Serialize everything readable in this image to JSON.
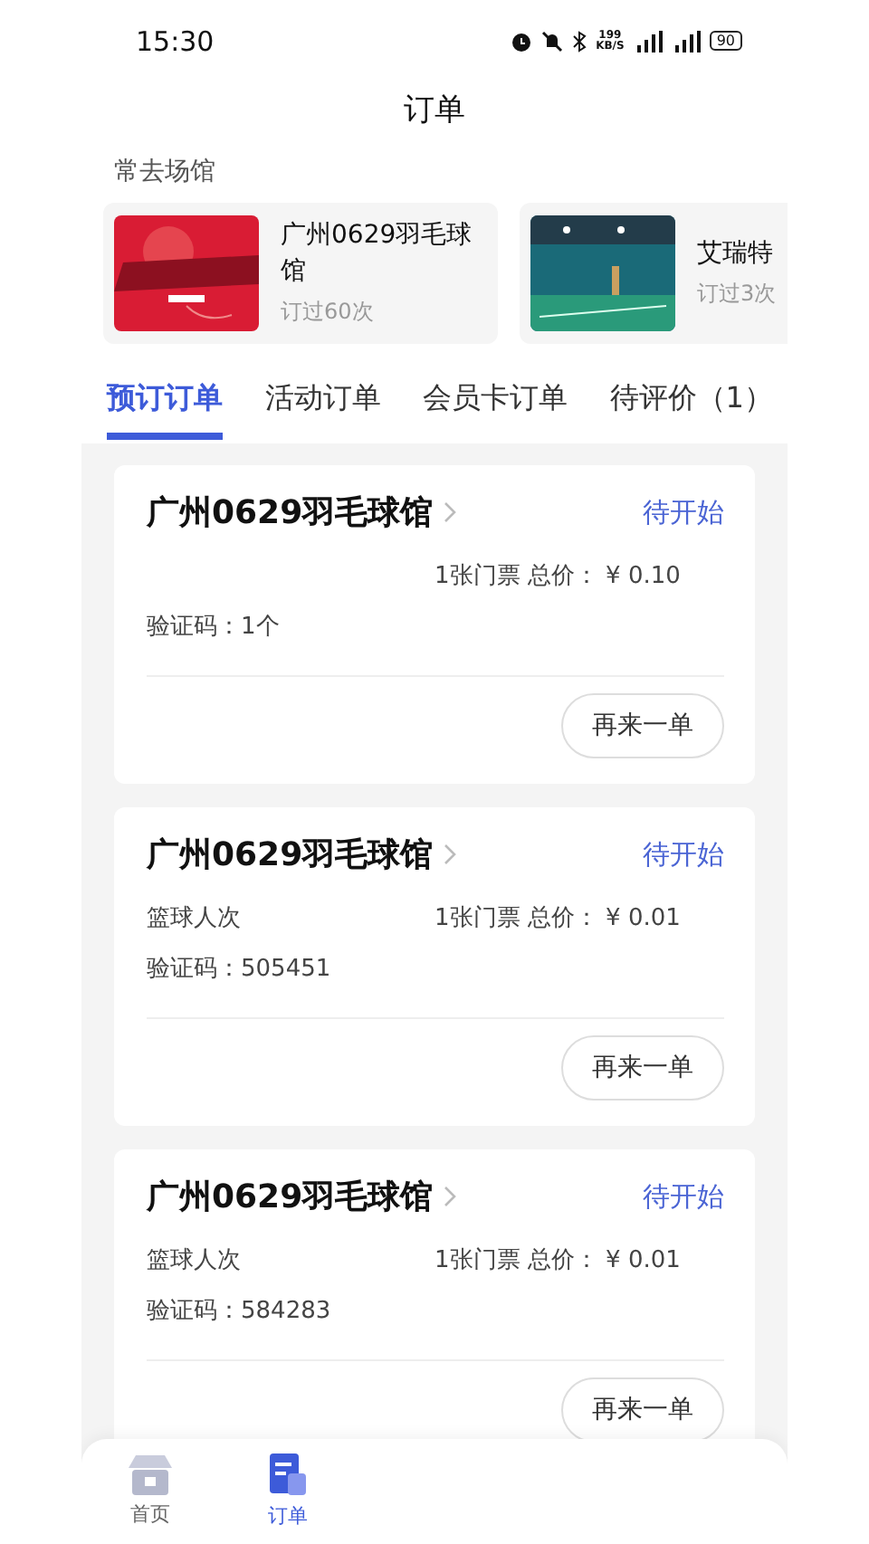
{
  "status_bar": {
    "time": "15:30",
    "speed": "199",
    "speed_unit": "KB/S",
    "battery": "90"
  },
  "title": "订单",
  "frequent": {
    "heading": "常去场馆",
    "venues": [
      {
        "name": "广州0629羽毛球馆",
        "visits": "订过60次"
      },
      {
        "name": "艾瑞特",
        "visits": "订过3次"
      }
    ]
  },
  "tabs": [
    {
      "label": "预订订单",
      "selected": true
    },
    {
      "label": "活动订单",
      "selected": false
    },
    {
      "label": "会员卡订单",
      "selected": false
    },
    {
      "label": "待评价（1）",
      "selected": false
    }
  ],
  "orders": [
    {
      "venue": "广州0629羽毛球馆",
      "status": "待开始",
      "tickets": "1张门票 总价：",
      "price": "¥ 0.10",
      "code": "验证码：1个",
      "button": "再来一单"
    },
    {
      "venue": "广州0629羽毛球馆",
      "status": "待开始",
      "item": "篮球人次",
      "tickets": "1张门票 总价：",
      "price": "¥ 0.01",
      "code": "验证码：505451",
      "button": "再来一单"
    },
    {
      "venue": "广州0629羽毛球馆",
      "status": "待开始",
      "item": "篮球人次",
      "tickets": "1张门票 总价：",
      "price": "¥ 0.01",
      "code": "验证码：584283",
      "button": "再来一单"
    }
  ],
  "nav": [
    {
      "label": "首页",
      "selected": false,
      "kind": "home"
    },
    {
      "label": "订单",
      "selected": true,
      "kind": "orders"
    }
  ]
}
